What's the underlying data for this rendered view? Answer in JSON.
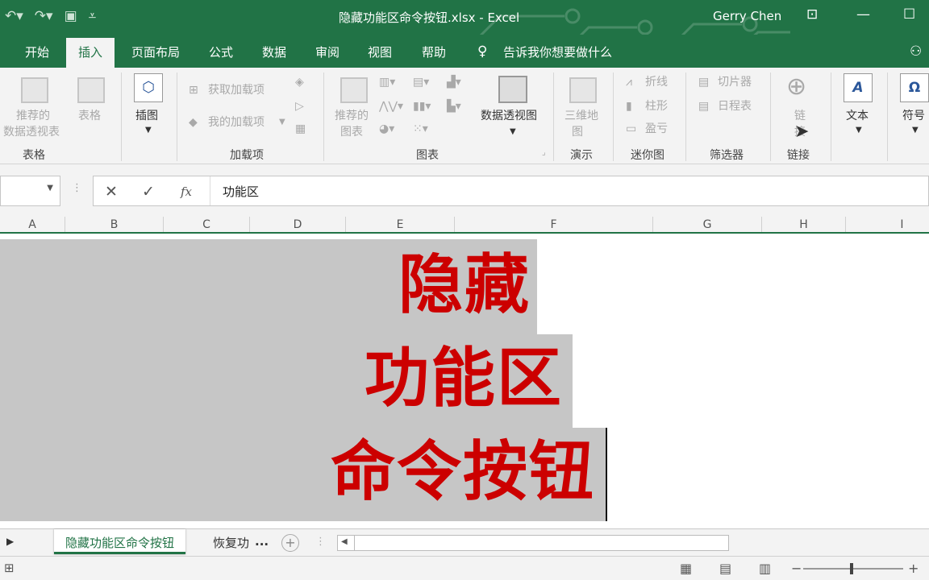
{
  "window": {
    "title": "隐藏功能区命令按钮.xlsx  -  Excel",
    "user": "Gerry Chen"
  },
  "tabs": [
    "开始",
    "插入",
    "页面布局",
    "公式",
    "数据",
    "审阅",
    "视图",
    "帮助"
  ],
  "active_tab": "插入",
  "tell_me": "告诉我你想要做什么",
  "ribbon": {
    "groups": {
      "tables": "表格",
      "addins": "加载项",
      "charts": "图表",
      "tours": "演示",
      "sparklines": "迷你图",
      "filters": "筛选器",
      "links": "链接"
    },
    "buttons": {
      "recommended_pivot_1": "推荐的",
      "recommended_pivot_2": "数据透视表",
      "table": "表格",
      "illustrations": "插图",
      "get_addins": "获取加载项",
      "my_addins": "我的加载项",
      "recommended_charts_1": "推荐的",
      "recommended_charts_2": "图表",
      "pivot_chart": "数据透视图",
      "map3d_1": "三维地",
      "map3d_2": "图",
      "spark_line": "折线",
      "spark_column": "柱形",
      "spark_winloss": "盈亏",
      "slicer": "切片器",
      "timeline": "日程表",
      "link_1": "链",
      "link_2": "接",
      "text": "文本",
      "symbols": "符号"
    }
  },
  "formula_bar": {
    "value": "功能区",
    "fx": "fx"
  },
  "columns": [
    "A",
    "B",
    "C",
    "D",
    "E",
    "F",
    "G",
    "H",
    "I"
  ],
  "cells": {
    "line1": "隐藏",
    "line2": "功能区",
    "line3": "命令按钮"
  },
  "sheets": [
    "隐藏功能区命令按钮",
    "恢复功"
  ],
  "sheet_more": "...",
  "colors": {
    "excel_green": "#217346",
    "text_red": "#cc0000",
    "selection_gray": "#c6c6c6"
  }
}
